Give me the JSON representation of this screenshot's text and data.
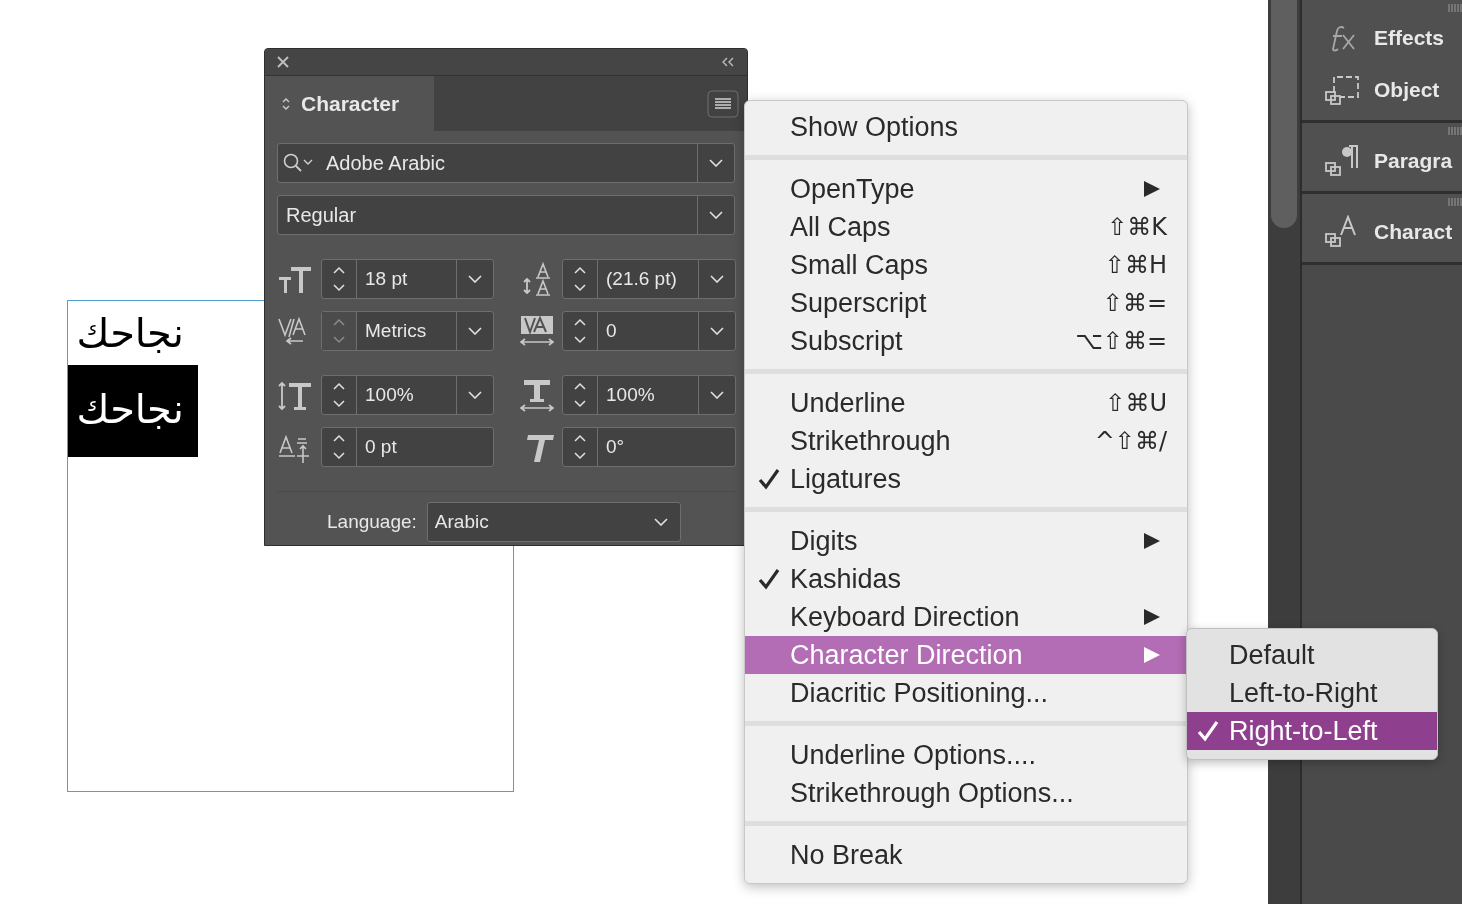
{
  "canvas": {
    "text_lines": [
      {
        "text": "نجاحك",
        "highlighted": false
      },
      {
        "text": "نجاحك",
        "highlighted": true
      }
    ]
  },
  "character_panel": {
    "title": "Character",
    "font_family": "Adobe Arabic",
    "font_style": "Regular",
    "field_rows": [
      [
        {
          "kind": "size",
          "value": "18 pt",
          "dropdown": true,
          "disabled": false
        },
        {
          "kind": "leading",
          "value": "(21.6 pt)",
          "dropdown": true,
          "disabled": false
        }
      ],
      [
        {
          "kind": "kerning",
          "value": "Metrics",
          "dropdown": true,
          "disabled": true
        },
        {
          "kind": "tracking",
          "value": "0",
          "dropdown": true,
          "disabled": false
        }
      ],
      [
        {
          "kind": "vscale",
          "value": "100%",
          "dropdown": true,
          "disabled": false
        },
        {
          "kind": "hscale",
          "value": "100%",
          "dropdown": true,
          "disabled": false
        }
      ],
      [
        {
          "kind": "baseline",
          "value": "0 pt",
          "dropdown": false,
          "disabled": false
        },
        {
          "kind": "skew",
          "value": "0°",
          "dropdown": false,
          "disabled": false
        }
      ]
    ],
    "language_label": "Language:",
    "language": "Arabic"
  },
  "menu": {
    "sections": [
      [
        {
          "label": "Show Options",
          "checked": false,
          "submenu": false,
          "selected": false
        }
      ],
      [
        {
          "label": "OpenType",
          "checked": false,
          "submenu": true,
          "selected": false
        },
        {
          "label": "All Caps",
          "shortcut": "⇧⌘K",
          "checked": false,
          "submenu": false,
          "selected": false
        },
        {
          "label": "Small Caps",
          "shortcut": "⇧⌘H",
          "checked": false,
          "submenu": false,
          "selected": false
        },
        {
          "label": "Superscript",
          "shortcut": "⇧⌘=",
          "checked": false,
          "submenu": false,
          "selected": false
        },
        {
          "label": "Subscript",
          "shortcut": "⌥⇧⌘=",
          "checked": false,
          "submenu": false,
          "selected": false
        }
      ],
      [
        {
          "label": "Underline",
          "shortcut": "⇧⌘U",
          "checked": false,
          "submenu": false,
          "selected": false
        },
        {
          "label": "Strikethrough",
          "shortcut": "^⇧⌘/",
          "checked": false,
          "submenu": false,
          "selected": false
        },
        {
          "label": "Ligatures",
          "checked": true,
          "submenu": false,
          "selected": false
        }
      ],
      [
        {
          "label": "Digits",
          "checked": false,
          "submenu": true,
          "selected": false
        },
        {
          "label": "Kashidas",
          "checked": true,
          "submenu": false,
          "selected": false
        },
        {
          "label": "Keyboard Direction",
          "checked": false,
          "submenu": true,
          "selected": false
        },
        {
          "label": "Character Direction",
          "checked": false,
          "submenu": true,
          "selected": true
        },
        {
          "label": "Diacritic Positioning...",
          "checked": false,
          "submenu": false,
          "selected": false
        }
      ],
      [
        {
          "label": "Underline Options....",
          "checked": false,
          "submenu": false,
          "selected": false
        },
        {
          "label": "Strikethrough Options...",
          "checked": false,
          "submenu": false,
          "selected": false
        }
      ],
      [
        {
          "label": "No Break",
          "checked": false,
          "submenu": false,
          "selected": false
        }
      ]
    ]
  },
  "submenu": {
    "items": [
      {
        "label": "Default",
        "checked": false,
        "selected": false
      },
      {
        "label": "Left-to-Right",
        "checked": false,
        "selected": false
      },
      {
        "label": "Right-to-Left",
        "checked": true,
        "selected": true
      }
    ]
  },
  "dock": {
    "groups": [
      {
        "items": [
          {
            "label": "Effects",
            "kind": "fx"
          },
          {
            "label": "Object",
            "kind": "object"
          }
        ]
      },
      {
        "items": [
          {
            "label": "Paragra",
            "kind": "paragraph"
          }
        ]
      },
      {
        "items": [
          {
            "label": "Charact",
            "kind": "character"
          }
        ]
      }
    ]
  }
}
